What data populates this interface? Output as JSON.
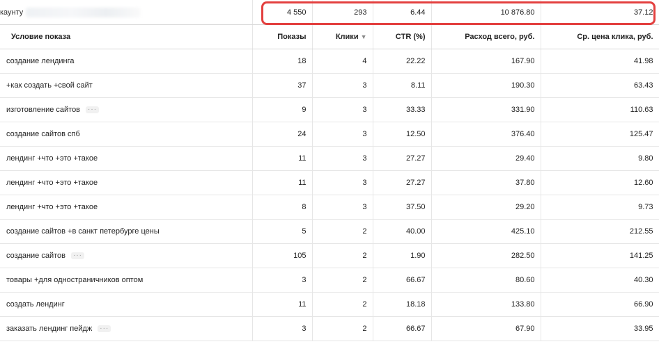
{
  "summary": {
    "label": "каунту",
    "values": [
      "4 550",
      "293",
      "6.44",
      "10 876.80",
      "37.12"
    ]
  },
  "columns": {
    "condition": "Условие показа",
    "shows": "Показы",
    "clicks": "Клики",
    "ctr": "CTR (%)",
    "cost": "Расход всего, руб.",
    "avg_cpc": "Ср. цена клика, руб."
  },
  "sort_icon": "sort-down-arrow",
  "highlight_color": "#e3403f",
  "rows": [
    {
      "condition": "создание лендинга",
      "more": "",
      "shows": "18",
      "clicks": "4",
      "ctr": "22.22",
      "cost": "167.90",
      "cpc": "41.98"
    },
    {
      "condition": "+как создать +свой сайт",
      "more": "",
      "shows": "37",
      "clicks": "3",
      "ctr": "8.11",
      "cost": "190.30",
      "cpc": "63.43"
    },
    {
      "condition": "изготовление сайтов",
      "more": "···",
      "shows": "9",
      "clicks": "3",
      "ctr": "33.33",
      "cost": "331.90",
      "cpc": "110.63"
    },
    {
      "condition": "создание сайтов спб",
      "more": "",
      "shows": "24",
      "clicks": "3",
      "ctr": "12.50",
      "cost": "376.40",
      "cpc": "125.47"
    },
    {
      "condition": "лендинг +что +это +такое",
      "more": "",
      "shows": "11",
      "clicks": "3",
      "ctr": "27.27",
      "cost": "29.40",
      "cpc": "9.80"
    },
    {
      "condition": "лендинг +что +это +такое",
      "more": "",
      "shows": "11",
      "clicks": "3",
      "ctr": "27.27",
      "cost": "37.80",
      "cpc": "12.60"
    },
    {
      "condition": "лендинг +что +это +такое",
      "more": "",
      "shows": "8",
      "clicks": "3",
      "ctr": "37.50",
      "cost": "29.20",
      "cpc": "9.73"
    },
    {
      "condition": "создание сайтов +в санкт петербурге цены",
      "more": "",
      "shows": "5",
      "clicks": "2",
      "ctr": "40.00",
      "cost": "425.10",
      "cpc": "212.55"
    },
    {
      "condition": "создание сайтов",
      "more": "···",
      "shows": "105",
      "clicks": "2",
      "ctr": "1.90",
      "cost": "282.50",
      "cpc": "141.25"
    },
    {
      "condition": "товары +для одностраничников оптом",
      "more": "",
      "shows": "3",
      "clicks": "2",
      "ctr": "66.67",
      "cost": "80.60",
      "cpc": "40.30"
    },
    {
      "condition": "создать лендинг",
      "more": "",
      "shows": "11",
      "clicks": "2",
      "ctr": "18.18",
      "cost": "133.80",
      "cpc": "66.90"
    },
    {
      "condition": "заказать лендинг пейдж",
      "more": "···",
      "shows": "3",
      "clicks": "2",
      "ctr": "66.67",
      "cost": "67.90",
      "cpc": "33.95"
    }
  ]
}
